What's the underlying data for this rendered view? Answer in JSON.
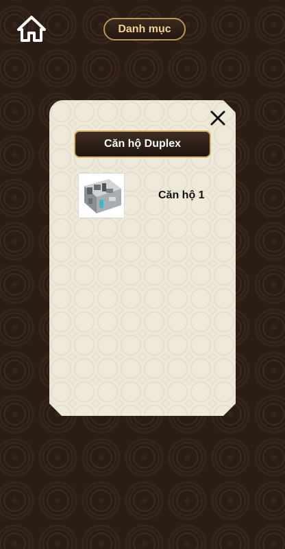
{
  "header": {
    "home_icon": "home-icon",
    "category_label": "Danh mục"
  },
  "panel": {
    "close_icon": "close-icon",
    "title": "Căn hộ Duplex",
    "items": [
      {
        "label": "Căn hộ 1",
        "thumbnail_icon": "apartment-3d-floorplan"
      }
    ]
  },
  "colors": {
    "background": "#2b1d15",
    "accent_gold": "#d9b263",
    "panel_bg": "#efe9da",
    "button_dark": "#2a1c14"
  }
}
